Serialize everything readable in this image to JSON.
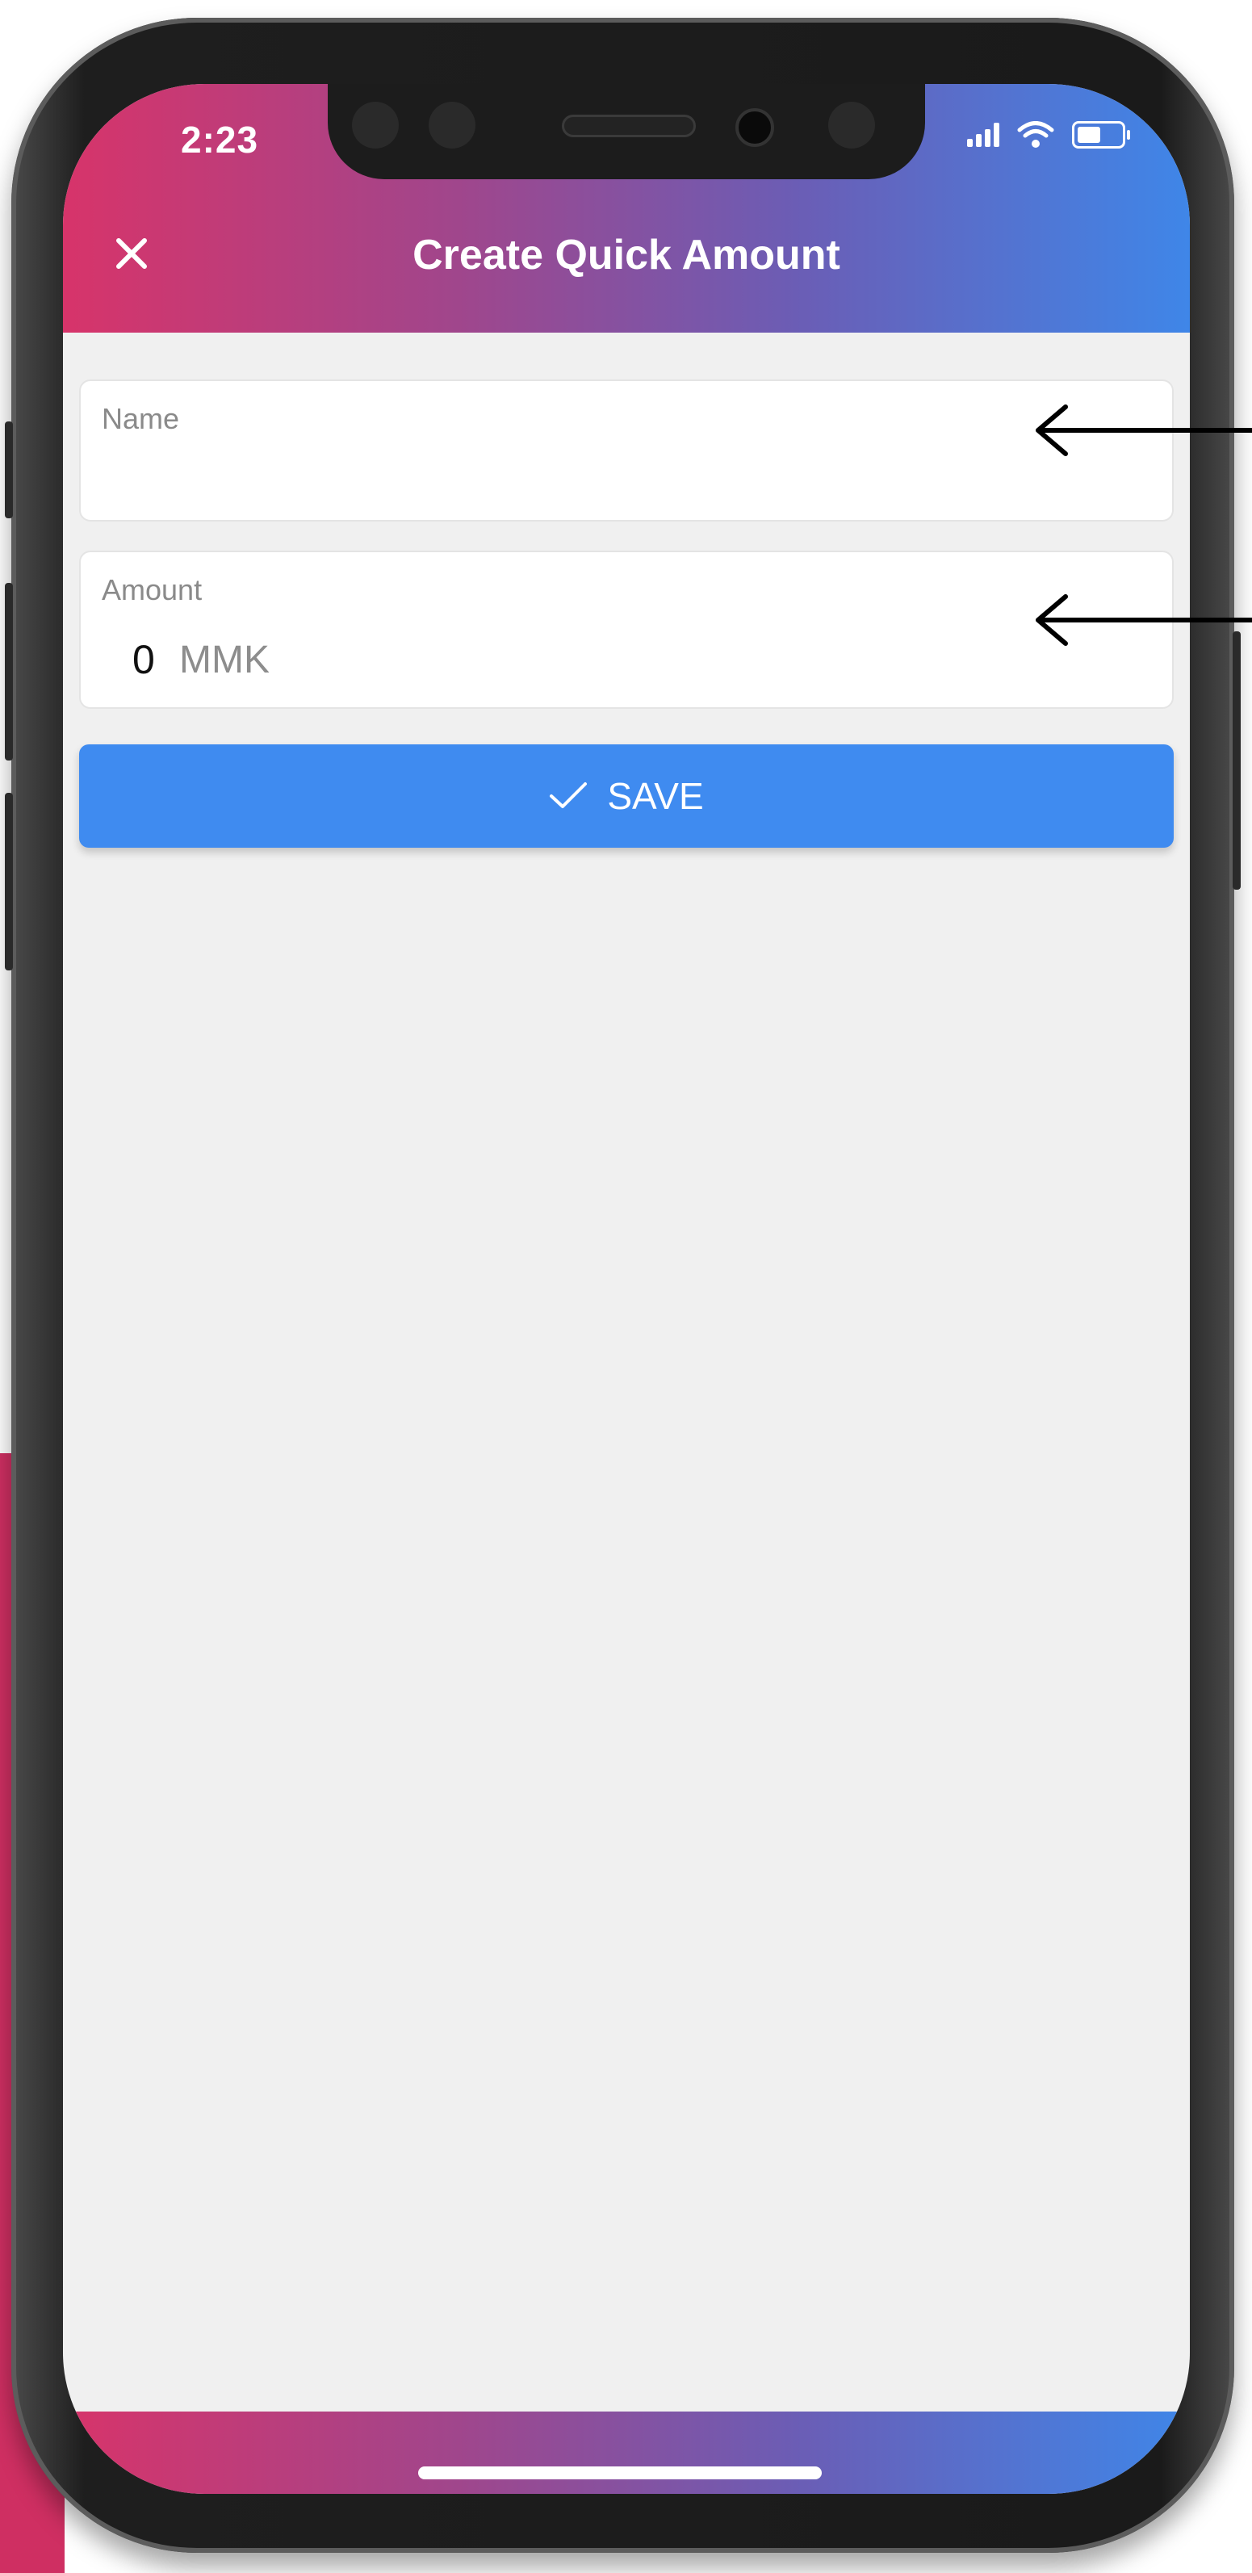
{
  "status_bar": {
    "time": "2:23"
  },
  "header": {
    "title": "Create Quick Amount",
    "close_icon": "close-icon"
  },
  "form": {
    "name": {
      "label": "Name",
      "value": ""
    },
    "amount": {
      "label": "Amount",
      "value": "0",
      "unit": "MMK"
    }
  },
  "save_button": {
    "label": "SAVE",
    "icon": "check-icon"
  },
  "colors": {
    "gradient_start": "#d7346a",
    "gradient_end": "#3f86e8",
    "save_button": "#3f8bf0",
    "screen_background": "#f0f0f0"
  }
}
